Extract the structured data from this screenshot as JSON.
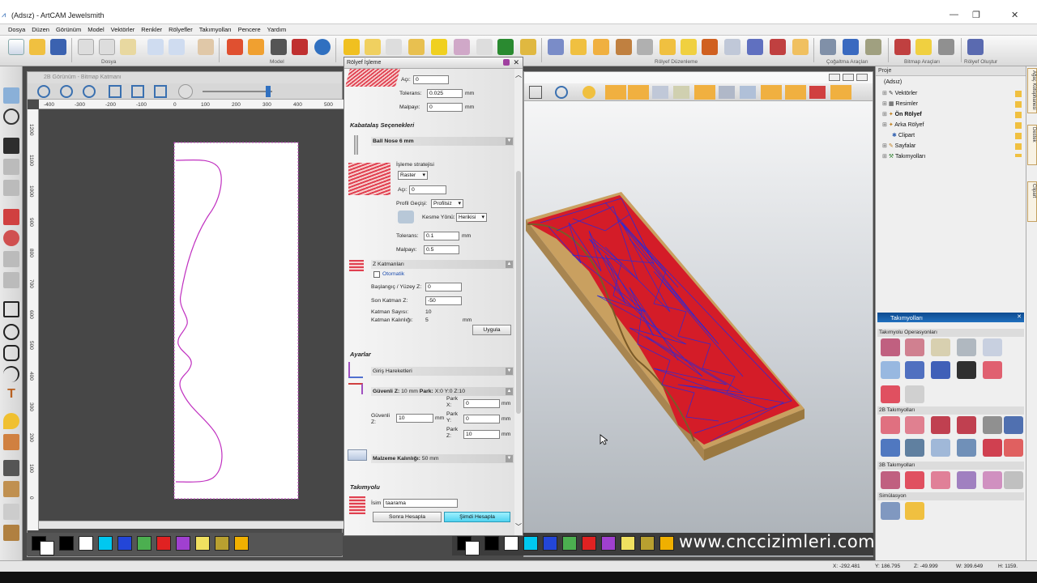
{
  "window": {
    "title": "(Adsız) - ArtCAM Jewelsmith",
    "minimize": "—",
    "restore": "❐",
    "close": "✕"
  },
  "menu": [
    "Dosya",
    "Düzen",
    "Görünüm",
    "Model",
    "Vektörler",
    "Renkler",
    "Rölyefler",
    "Takımyolları",
    "Pencere",
    "Yardım"
  ],
  "toolbar_groups": [
    "Dosya",
    "Model",
    "Rölyef Düzenleme",
    "Çoğaltma Araçları",
    "Bitmap Araçları",
    "Rölyef Oluştur"
  ],
  "view2d": {
    "title": "2B Görünüm - Bitmap Katmanı",
    "ruler_h": [
      "-400",
      "-300",
      "-200",
      "-100",
      "0",
      "100",
      "200",
      "300",
      "400",
      "500"
    ],
    "ruler_v": [
      "1200",
      "1100",
      "1000",
      "900",
      "800",
      "700",
      "600",
      "500",
      "400",
      "300",
      "200",
      "100",
      "0"
    ]
  },
  "dialog": {
    "title": "Rölyef İşleme",
    "aci_top_label": "Açı:",
    "aci_top_value": "0",
    "tolerans_top_label": "Tolerans:",
    "tolerans_top_value": "0.025",
    "tolerans_top_unit": "mm",
    "malpayi_top_label": "Malpayı:",
    "malpayi_top_value": "0",
    "malpayi_top_unit": "mm",
    "kabatalas_heading": "Kabatalaş Seçenekleri",
    "tool_name": "Ball Nose 6 mm",
    "strategy_label": "İşleme stratejisi",
    "strategy_value": "Raster",
    "aci_label": "Açı:",
    "aci_value": "0",
    "profil_label": "Profil Geçişi:",
    "profil_value": "Profilsiz",
    "kesme_label": "Kesme Yönü:",
    "kesme_value": "Herikisi",
    "tolerans_label": "Tolerans:",
    "tolerans_value": "0.1",
    "tolerans_unit": "mm",
    "malpayi_label": "Malpayı:",
    "malpayi_value": "0.5",
    "zkatman_bar": "Z Katmanları",
    "otomatik_label": "Otomatik",
    "baslangic_label": "Başlangıç / Yüzey Z:",
    "baslangic_value": "0",
    "son_label": "Son Katman Z:",
    "son_value": "-50",
    "sayisi_label": "Katman Sayısı:",
    "sayisi_value": "10",
    "kalinlik_label": "Katman Kalınlığı:",
    "kalinlik_value": "5",
    "kalinlik_unit": "mm",
    "uygula_button": "Uygula",
    "ayarlar_heading": "Ayarlar",
    "giris_bar": "Giriş Hareketleri",
    "guvenli_bar_bold": "Güvenli Z:",
    "guvenli_bar_val": "10 mm",
    "park_bold": "Park:",
    "park_val": "X:0 Y:0 Z:10",
    "guvenli_label": "Güvenli Z:",
    "guvenli_value": "10",
    "guvenli_unit": "mm",
    "parkx_label": "Park X:",
    "parkx_value": "0",
    "parky_label": "Park Y:",
    "parky_value": "0",
    "parkz_label": "Park Z:",
    "parkz_value": "10",
    "park_unit": "mm",
    "malzeme_bold": "Malzeme Kalınlığı:",
    "malzeme_val": "50 mm",
    "takimyolu_heading": "Takımyolu",
    "isim_label": "İsim",
    "isim_value": "taarama",
    "sonra_button": "Sonra Hesapla",
    "simdi_button": "Şimdi Hesapla",
    "collapse_arrow": "▲",
    "expand_arrow": "▼"
  },
  "project": {
    "header": "Proje",
    "root": "(Adsız)",
    "items": [
      "Vektörler",
      "Resimler",
      "Ön Rölyef",
      "Arka Rölyef",
      "Clipart",
      "Sayfalar",
      "Takımyolları"
    ]
  },
  "toolpaths": {
    "title": "Takımyolları",
    "groups": [
      "Takımyolu Operasyonları",
      "2B Takımyolları",
      "3B Takımyolları",
      "Simülasyon"
    ]
  },
  "side_tabs": [
    "Ağaç Kütüphanesi",
    "Destek",
    "Clipart"
  ],
  "status": {
    "x": "X: -292.481",
    "y": "Y: 186.795",
    "z": "Z: -49.999",
    "w": "W: 399.649",
    "h": "H: 1159."
  },
  "watermark": "www.cnccizimleri.com",
  "colors": {
    "swatches": [
      "#000000",
      "#ffffff",
      "#00c8f0",
      "#2346d8",
      "#4caf50",
      "#e02222",
      "#a040d0",
      "#f0e060",
      "#b8a030",
      "#f0b000"
    ]
  }
}
